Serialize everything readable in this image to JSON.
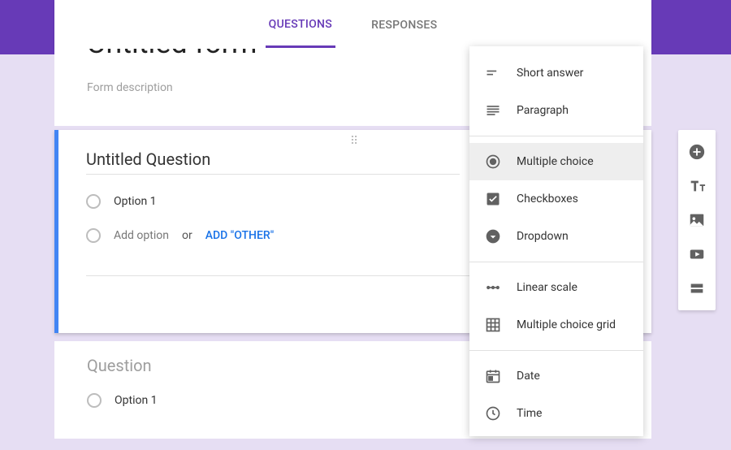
{
  "tabs": {
    "questions": "QUESTIONS",
    "responses": "RESPONSES"
  },
  "header": {
    "title": "Untitled form",
    "description": "Form description"
  },
  "question1": {
    "title": "Untitled Question",
    "option1": "Option 1",
    "add_option": "Add option",
    "or": "or",
    "add_other": "ADD \"OTHER\""
  },
  "question2": {
    "title": "Question",
    "option1": "Option 1"
  },
  "menu": {
    "short_answer": "Short answer",
    "paragraph": "Paragraph",
    "multiple_choice": "Multiple choice",
    "checkboxes": "Checkboxes",
    "dropdown": "Dropdown",
    "linear_scale": "Linear scale",
    "mc_grid": "Multiple choice grid",
    "date": "Date",
    "time": "Time"
  }
}
